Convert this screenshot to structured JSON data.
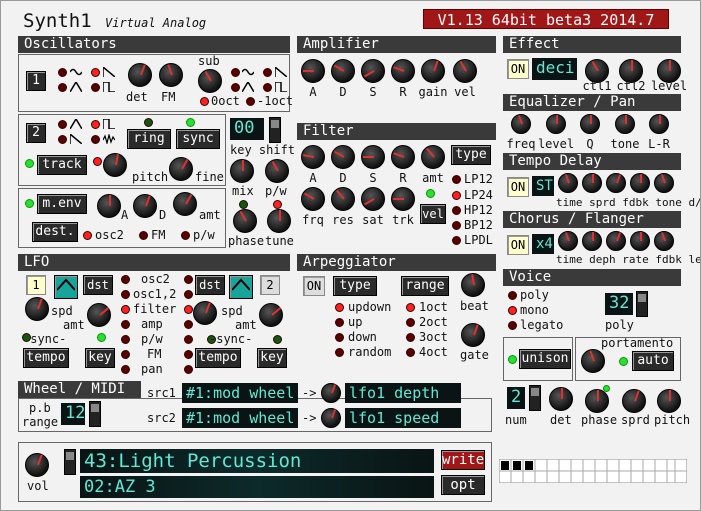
{
  "app": {
    "title": "Synth1",
    "subtitle": "Virtual Analog",
    "version": "V1.13 64bit beta3 2014.7"
  },
  "osc": {
    "header": "Oscillators",
    "osc1": "1",
    "osc2": "2",
    "det": "det",
    "fm": "FM",
    "sub": "sub",
    "oct0": "0oct",
    "octm1": "-1oct",
    "ring": "ring",
    "sync": "sync",
    "track": "track",
    "pitch": "pitch",
    "fine": "fine",
    "key_shift_value": "00",
    "key_shift": "key shift",
    "mix": "mix",
    "pw": "p/w",
    "phase": "phase",
    "tune": "tune",
    "menv": "m.env",
    "a": "A",
    "d": "D",
    "amt": "amt",
    "dest": "dest.",
    "osc2_dest": "osc2",
    "fm_dest": "FM",
    "pw_dest": "p/w"
  },
  "amp": {
    "header": "Amplifier",
    "a": "A",
    "d": "D",
    "s": "S",
    "r": "R",
    "gain": "gain",
    "vel": "vel"
  },
  "filter": {
    "header": "Filter",
    "a": "A",
    "d": "D",
    "s": "S",
    "r": "R",
    "amt": "amt",
    "type": "type",
    "frq": "frq",
    "res": "res",
    "sat": "sat",
    "trk": "trk",
    "vel": "vel",
    "types": [
      "LP12",
      "LP24",
      "HP12",
      "BP12",
      "LPDL"
    ]
  },
  "effect": {
    "header": "Effect",
    "on": "ON",
    "type": "deci.",
    "ctl1": "ctl1",
    "ctl2": "ctl2",
    "level": "level"
  },
  "eq": {
    "header": "Equalizer / Pan",
    "freq": "freq",
    "level": "level",
    "q": "Q",
    "tone": "tone",
    "lr": "L-R"
  },
  "delay": {
    "header": "Tempo Delay",
    "on": "ON",
    "type": "ST",
    "labels": "time sprd fdbk tone d/w"
  },
  "chorus": {
    "header": "Chorus / Flanger",
    "on": "ON",
    "type": "x4",
    "labels": "time deph rate fdbk levl"
  },
  "lfo": {
    "header": "LFO",
    "n1": "1",
    "n2": "2",
    "dst": "dst",
    "spd": "spd",
    "amt": "amt",
    "sync": "-sync-",
    "tempo": "tempo",
    "key": "key",
    "dests": [
      "osc2",
      "osc1,2",
      "filter",
      "amp",
      "p/w",
      "FM",
      "pan"
    ]
  },
  "arp": {
    "header": "Arpeggiator",
    "on": "ON",
    "type": "type",
    "range": "range",
    "beat": "beat",
    "gate": "gate",
    "types": [
      "updown",
      "up",
      "down",
      "random"
    ],
    "ranges": [
      "1oct",
      "2oct",
      "3oct",
      "4oct"
    ]
  },
  "voice": {
    "header": "Voice",
    "poly": "poly",
    "mono": "mono",
    "legato": "legato",
    "poly_value": "32",
    "poly_label": "poly",
    "portamento": "portamento",
    "unison": "unison",
    "auto": "auto",
    "num_value": "2",
    "num": "num",
    "det": "det",
    "phase": "phase",
    "sprd": "sprd",
    "pitch": "pitch"
  },
  "wheel": {
    "header": "Wheel / MIDI",
    "pb": "p.b",
    "range": "range",
    "pb_value": "12",
    "src1": "src1",
    "src2": "src2",
    "src1_value": "#1:mod wheel",
    "src2_value": "#1:mod wheel",
    "arrow": "->",
    "dst1": "lfo1 depth",
    "dst2": "lfo1 speed"
  },
  "bottom": {
    "vol": "vol",
    "patch": "43:Light Percussion",
    "bank": "02:AZ 3",
    "write": "write",
    "opt": "opt"
  }
}
